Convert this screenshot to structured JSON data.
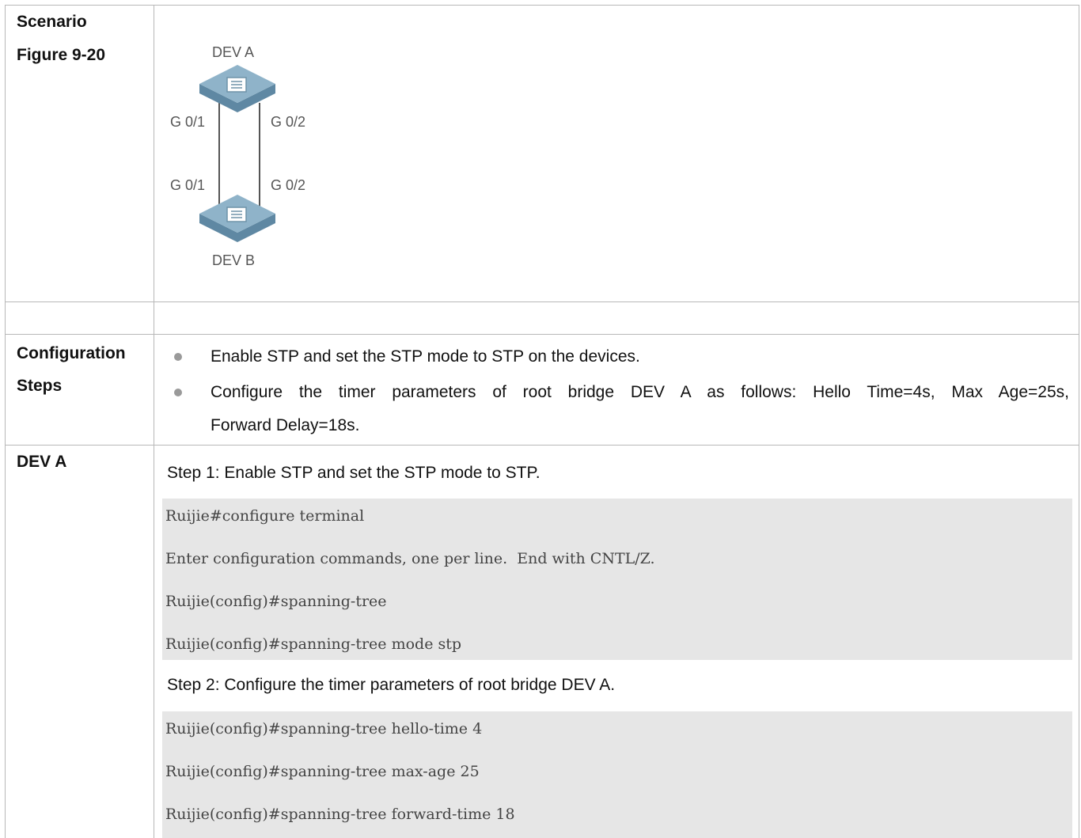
{
  "rows": {
    "scenario": {
      "label_line1": "Scenario",
      "label_line2": "Figure 9-20"
    },
    "diagram": {
      "dev_a": "DEV A",
      "dev_b": "DEV B",
      "ports_top_left": "G 0/1",
      "ports_top_right": "G 0/2",
      "ports_bottom_left": "G 0/1",
      "ports_bottom_right": "G 0/2",
      "colors": {
        "switch_top": "#8fb3c9",
        "switch_side": "#5f88a3",
        "link": "#555555"
      }
    },
    "config_steps": {
      "label_line1": "Configuration",
      "label_line2": "Steps",
      "bullets": [
        "Enable STP and set the STP mode to STP on the devices.",
        "Configure the timer parameters of root bridge DEV A as follows: Hello Time=4s, Max Age=25s,",
        "Forward Delay=18s."
      ]
    },
    "dev_a": {
      "label": "DEV A",
      "step1": "Step 1: Enable STP and set the STP mode to STP.",
      "code1": [
        "Ruijie#configure terminal",
        "Enter configuration commands, one per line.  End with CNTL/Z.",
        "Ruijie(config)#spanning-tree",
        "Ruijie(config)#spanning-tree mode stp"
      ],
      "step2": "Step 2: Configure the timer parameters of root bridge DEV A.",
      "code2": [
        "Ruijie(config)#spanning-tree hello-time 4",
        "Ruijie(config)#spanning-tree max-age 25",
        "Ruijie(config)#spanning-tree forward-time 18"
      ]
    }
  }
}
